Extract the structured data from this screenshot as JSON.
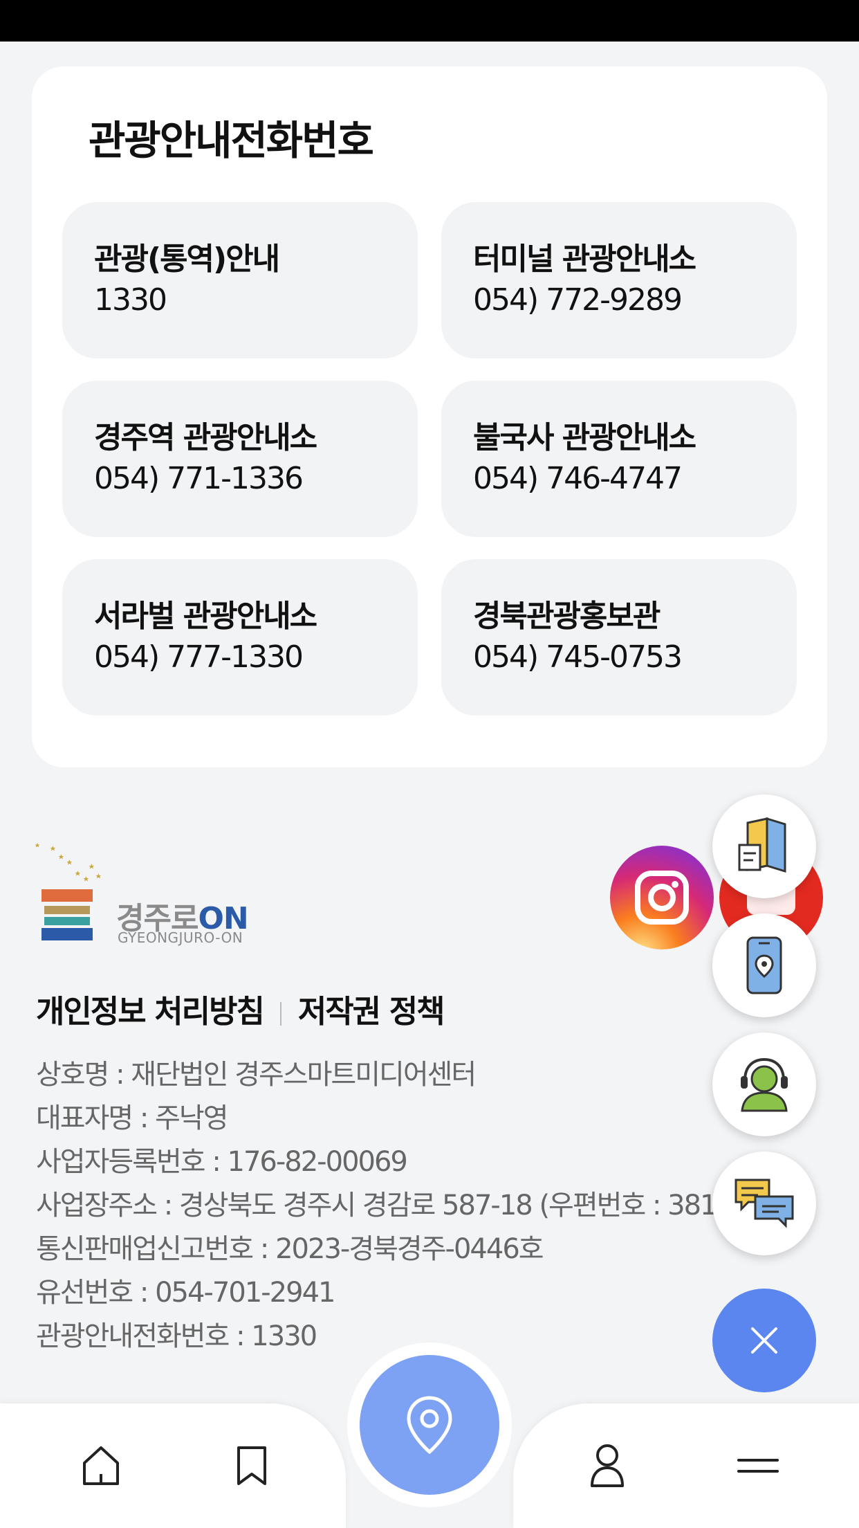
{
  "card": {
    "title": "관광안내전화번호",
    "tiles": [
      {
        "name": "관광(통역)안내",
        "number": "1330"
      },
      {
        "name": "터미널 관광안내소",
        "number": "054) 772-9289"
      },
      {
        "name": "경주역 관광안내소",
        "number": "054) 771-1336"
      },
      {
        "name": "불국사 관광안내소",
        "number": "054) 746-4747"
      },
      {
        "name": "서라벌 관광안내소",
        "number": "054) 777-1330"
      },
      {
        "name": "경북관광홍보관",
        "number": "054) 745-0753"
      }
    ]
  },
  "footer": {
    "logo_ko_prefix": "경주로",
    "logo_ko_suffix": "ON",
    "logo_en": "GYEONGJURO-ON",
    "links": {
      "privacy": "개인정보 처리방침",
      "copyright": "저작권 정책"
    },
    "info": [
      "상호명 : 재단법인 경주스마트미디어센터",
      "대표자명 : 주낙영",
      "사업자등록번호 : 176-82-00069",
      "사업장주소 : 경상북도 경주시 경감로 587-18 (우편번호 : 38118)",
      "통신판매업신고번호 : 2023-경북경주-0446호",
      "유선번호 : 054-701-2941",
      "관광안내전화번호 : 1330"
    ]
  },
  "floating": {
    "icons": [
      "book-map-icon",
      "phone-location-icon",
      "support-agent-icon",
      "chat-icon",
      "close-icon",
      "instagram-icon",
      "youtube-icon"
    ]
  },
  "nav": {
    "icons": [
      "home-icon",
      "bookmark-icon",
      "location-pin-icon",
      "user-icon",
      "menu-icon"
    ]
  },
  "colors": {
    "background": "#f3f4f6",
    "tile": "#f2f3f5",
    "accent": "#5b86f0",
    "nav_center": "#7ea2f3"
  }
}
